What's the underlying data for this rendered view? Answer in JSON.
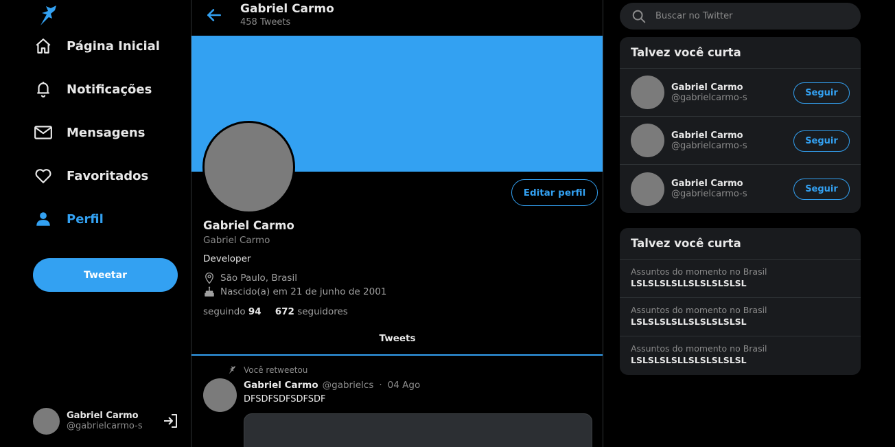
{
  "colors": {
    "accent": "#33a1f2",
    "background": "#000000",
    "panel": "#191b1e",
    "muted": "#8b8b8b"
  },
  "sidebar": {
    "logo_icon": "bird-logo-icon",
    "items": [
      {
        "label": "Página Inicial",
        "icon": "home-icon"
      },
      {
        "label": "Notificações",
        "icon": "bell-icon"
      },
      {
        "label": "Mensagens",
        "icon": "mail-icon"
      },
      {
        "label": "Favoritados",
        "icon": "heart-icon"
      },
      {
        "label": "Perfil",
        "icon": "person-icon",
        "active": true
      }
    ],
    "tweet_button": "Tweetar",
    "account": {
      "name": "Gabriel Carmo",
      "handle": "@gabrielcarmo-s"
    }
  },
  "header": {
    "name": "Gabriel Carmo",
    "tweet_count": "458 Tweets"
  },
  "profile": {
    "edit_button": "Editar perfil",
    "name": "Gabriel Carmo",
    "handle": "Gabriel Carmo",
    "bio": "Developer",
    "location": "São Paulo, Brasil",
    "birthday": "Nascido(a) em 21 de junho de 2001",
    "following_label": "seguindo",
    "following_count": "94",
    "followers_count": "672",
    "followers_label": "seguidores"
  },
  "tabs": {
    "tweets": "Tweets"
  },
  "tweet": {
    "retweet_label": "Você retweetou",
    "name": "Gabriel Carmo",
    "handle": "@gabrielcs",
    "separator": "·",
    "date": "04 Ago",
    "text": "DFSDFSDFSDFSDF"
  },
  "search": {
    "placeholder": "Buscar no Twitter"
  },
  "suggestions": {
    "title": "Talvez você curta",
    "items": [
      {
        "name": "Gabriel Carmo",
        "handle": "@gabrielcarmo-s",
        "button": "Seguir"
      },
      {
        "name": "Gabriel Carmo",
        "handle": "@gabrielcarmo-s",
        "button": "Seguir"
      },
      {
        "name": "Gabriel Carmo",
        "handle": "@gabrielcarmo-s",
        "button": "Seguir"
      }
    ]
  },
  "trends": {
    "title": "Talvez você curta",
    "items": [
      {
        "context": "Assuntos do momento no Brasil",
        "topic": "LSLSLSLSLLSLSLSLSLSL"
      },
      {
        "context": "Assuntos do momento no Brasil",
        "topic": "LSLSLSLSLLSLSLSLSLSL"
      },
      {
        "context": "Assuntos do momento no Brasil",
        "topic": "LSLSLSLSLLSLSLSLSLSL"
      }
    ]
  }
}
